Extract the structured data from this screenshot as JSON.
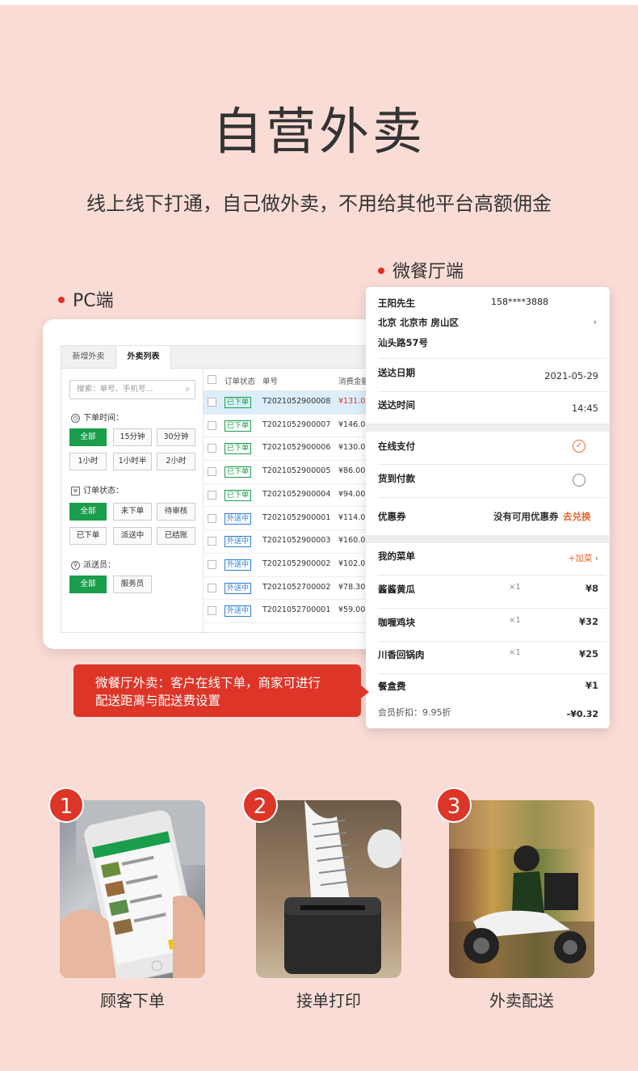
{
  "title": "自营外卖",
  "subtitle": "线上线下打通，自己做外卖，不用给其他平台高额佣金",
  "pc": {
    "label": "PC端",
    "tabs": [
      "新增外卖",
      "外卖列表"
    ],
    "search_placeholder": "搜索：单号、手机号...",
    "time_label": "下单时间：",
    "time_buttons": [
      "全部",
      "15分钟",
      "30分钟",
      "1小时",
      "1小时半",
      "2小时"
    ],
    "status_label": "订单状态：",
    "status_buttons": [
      "全部",
      "未下单",
      "待审核",
      "已下单",
      "派送中",
      "已结账"
    ],
    "courier_label": "派送员：",
    "courier_buttons": [
      "全部",
      "服务员"
    ],
    "columns": [
      "订单状态",
      "单号",
      "消费金额"
    ],
    "orders": [
      {
        "status": "已下单",
        "no": "T2021052900008",
        "amount": "¥131.0"
      },
      {
        "status": "已下单",
        "no": "T2021052900007",
        "amount": "¥146.0"
      },
      {
        "status": "已下单",
        "no": "T2021052900006",
        "amount": "¥130.0"
      },
      {
        "status": "已下单",
        "no": "T2021052900005",
        "amount": "¥86.00"
      },
      {
        "status": "已下单",
        "no": "T2021052900004",
        "amount": "¥94.00"
      },
      {
        "status": "外送中",
        "no": "T2021052900001",
        "amount": "¥114.0"
      },
      {
        "status": "外送中",
        "no": "T2021052900003",
        "amount": "¥160.0"
      },
      {
        "status": "外送中",
        "no": "T2021052900002",
        "amount": "¥102.0"
      },
      {
        "status": "外送中",
        "no": "T2021052700002",
        "amount": "¥78.30"
      },
      {
        "status": "外送中",
        "no": "T2021052700001",
        "amount": "¥59.00"
      }
    ]
  },
  "mobile": {
    "label": "微餐厅端",
    "customer_name": "王阳先生",
    "phone": "158****3888",
    "address_line1": "北京 北京市 房山区",
    "address_line2": "汕头路57号",
    "delivery_date_label": "送达日期",
    "delivery_date": "2021-05-29",
    "delivery_time_label": "送达时间",
    "delivery_time": "14:45",
    "pay_online": "在线支付",
    "pay_cod": "货到付款",
    "coupon_label": "优惠券",
    "coupon_none": "没有可用优惠券",
    "coupon_redeem": "去兑换",
    "my_dishes": "我的菜单",
    "add_dish": "+加菜",
    "dishes": [
      {
        "name": "酱酱黄瓜",
        "qty": "×1",
        "price": "¥8"
      },
      {
        "name": "咖喱鸡块",
        "qty": "×1",
        "price": "¥32"
      },
      {
        "name": "川香回锅肉",
        "qty": "×1",
        "price": "¥25"
      }
    ],
    "box_fee_label": "餐盒费",
    "box_fee": "¥1",
    "member_discount": "会员折扣：9.95折",
    "discount_value": "-¥0.32"
  },
  "callout": {
    "line1": "微餐厅外卖：客户在线下单，商家可进行",
    "line2": "配送距离与配送费设置"
  },
  "steps": [
    {
      "num": "1",
      "label": "顾客下单"
    },
    {
      "num": "2",
      "label": "接单打印"
    },
    {
      "num": "3",
      "label": "外卖配送"
    }
  ],
  "colors": {
    "accent_red": "#dd3528",
    "green": "#1a9e4b",
    "blue": "#2b7bd8",
    "orange": "#e8652b",
    "background": "#fadcd6"
  }
}
